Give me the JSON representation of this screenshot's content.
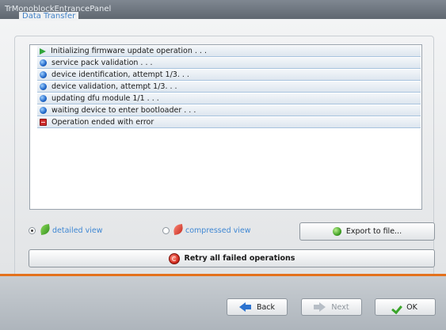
{
  "window": {
    "title": "TrMonoblockEntrancePanel"
  },
  "group": {
    "title": "Data Transfer"
  },
  "log": {
    "rows": [
      {
        "icon": "play-arrow-icon",
        "text": "Initializing firmware update operation . . ."
      },
      {
        "icon": "info-dot-icon",
        "text": "service pack validation . . ."
      },
      {
        "icon": "info-dot-icon",
        "text": "device identification, attempt 1/3. . ."
      },
      {
        "icon": "info-dot-icon",
        "text": "device validation, attempt 1/3. . ."
      },
      {
        "icon": "info-dot-icon",
        "text": "updating dfu module 1/1 . . ."
      },
      {
        "icon": "info-dot-icon",
        "text": "waiting device to enter bootloader . . ."
      },
      {
        "icon": "error-square-icon",
        "text": "Operation ended with error"
      }
    ]
  },
  "view_options": {
    "detailed_label": "detailed view",
    "compressed_label": "compressed view",
    "selected": "detailed"
  },
  "buttons": {
    "export_label": "Export to file...",
    "retry_label": "Retry all failed operations",
    "back_label": "Back",
    "next_label": "Next",
    "ok_label": "OK"
  },
  "colors": {
    "accent_blue": "#3f87d3",
    "accent_orange": "#e3711d",
    "error_red": "#cc2b2b",
    "success_green": "#2fa53a"
  }
}
